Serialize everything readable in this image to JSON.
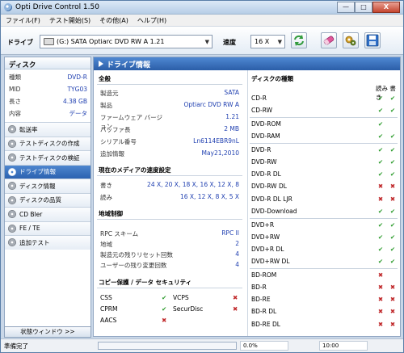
{
  "window": {
    "title": "Opti Drive Control 1.50",
    "minimize": "—",
    "maximize": "□",
    "close": "X"
  },
  "menu": [
    "ファイル(F)",
    "テスト開始(S)",
    "その他(A)",
    "ヘルプ(H)"
  ],
  "toolbar": {
    "drive_label": "ドライブ",
    "drive_value": "(G:)   SATA Optiarc DVD RW A 1.21",
    "speed_label": "速度",
    "speed_value": "16 X",
    "select_arrow": "▼"
  },
  "sidebar": {
    "header": "ディスク",
    "disc_info": [
      {
        "key": "種類",
        "value": "DVD-R"
      },
      {
        "key": "MID",
        "value": "TYG03"
      },
      {
        "key": "長さ",
        "value": "4.38 GB"
      },
      {
        "key": "内容",
        "value": "データ"
      }
    ],
    "nav": [
      {
        "label": "転送率",
        "active": false
      },
      {
        "label": "テストディスクの作成",
        "active": false
      },
      {
        "label": "テストディスクの検証",
        "active": false
      },
      {
        "label": "ドライブ情報",
        "active": true
      },
      {
        "label": "ディスク情報",
        "active": false
      },
      {
        "label": "ディスクの品質",
        "active": false
      },
      {
        "label": "CD Bler",
        "active": false
      },
      {
        "label": "FE / TE",
        "active": false
      },
      {
        "label": "追加テスト",
        "active": false
      }
    ],
    "status_window_button": "状態ウィンドウ >>"
  },
  "main": {
    "header": "ドライブ情報",
    "general": {
      "title": "全般",
      "rows": [
        {
          "key": "製造元",
          "value": "SATA"
        },
        {
          "key": "製品",
          "value": "Optiarc DVD RW A"
        },
        {
          "key": "ファームウェア バージョン",
          "value": "1.21"
        },
        {
          "key": "バッファ長",
          "value": "2 MB"
        },
        {
          "key": "シリアル番号",
          "value": "Ln6114EBR9nL"
        },
        {
          "key": "追加情報",
          "value": "May21,2010"
        }
      ]
    },
    "speed": {
      "title": "現在のメディアの速度設定",
      "rows": [
        {
          "key": "書き",
          "value": "24 X, 20 X, 18 X, 16 X, 12 X, 8"
        },
        {
          "key": "読み",
          "value": "16 X, 12 X, 8 X, 5 X"
        }
      ]
    },
    "region": {
      "title": "地域制御",
      "rows": [
        {
          "key": "RPC スキーム",
          "value": "RPC II"
        },
        {
          "key": "地域",
          "value": "2"
        },
        {
          "key": "製造元の残りリセット回数",
          "value": "4"
        },
        {
          "key": "ユーザーの残り変更回数",
          "value": "4"
        }
      ]
    },
    "protection": {
      "title": "コピー保護 / データ セキュリティ",
      "items": [
        {
          "name": "CSS",
          "supported": true
        },
        {
          "name": "VCPS",
          "supported": true
        },
        {
          "name": "CPRM",
          "supported": true
        },
        {
          "name": "SecurDisc",
          "supported": true
        },
        {
          "name": "AACS",
          "supported": false
        }
      ],
      "vcps_x": false,
      "securdisc_x": false
    },
    "disc_types": {
      "title": "ディスクの種類",
      "col_header": "読み 書き",
      "groups": [
        [
          {
            "name": "CD-R",
            "read": true,
            "write": true
          },
          {
            "name": "CD-RW",
            "read": true,
            "write": true
          }
        ],
        [
          {
            "name": "DVD-ROM",
            "read": true,
            "write": null
          },
          {
            "name": "DVD-RAM",
            "read": true,
            "write": true
          }
        ],
        [
          {
            "name": "DVD-R",
            "read": true,
            "write": true
          },
          {
            "name": "DVD-RW",
            "read": true,
            "write": true
          },
          {
            "name": "DVD-R DL",
            "read": true,
            "write": true
          },
          {
            "name": "DVD-RW DL",
            "read": false,
            "write": false
          },
          {
            "name": "DVD-R DL LJR",
            "read": false,
            "write": false
          },
          {
            "name": "DVD-Download",
            "read": true,
            "write": true
          }
        ],
        [
          {
            "name": "DVD+R",
            "read": true,
            "write": true
          },
          {
            "name": "DVD+RW",
            "read": true,
            "write": true
          },
          {
            "name": "DVD+R DL",
            "read": true,
            "write": true
          },
          {
            "name": "DVD+RW DL",
            "read": true,
            "write": true
          }
        ],
        [
          {
            "name": "BD-ROM",
            "read": false,
            "write": null
          },
          {
            "name": "BD-R",
            "read": false,
            "write": false
          },
          {
            "name": "BD-RE",
            "read": false,
            "write": false
          },
          {
            "name": "BD-R DL",
            "read": false,
            "write": false
          },
          {
            "name": "BD-RE DL",
            "read": false,
            "write": false
          }
        ]
      ]
    }
  },
  "status": {
    "text": "準備完了",
    "progress_percent": "0.0%",
    "progress": 0,
    "time": "10:00"
  },
  "marks": {
    "ok": "✔",
    "ng": "✖"
  },
  "colors": {
    "accent": "#2b5ea8",
    "ok": "#2a9a2a",
    "ng": "#c0282a",
    "value_text": "#1f3fb0"
  }
}
